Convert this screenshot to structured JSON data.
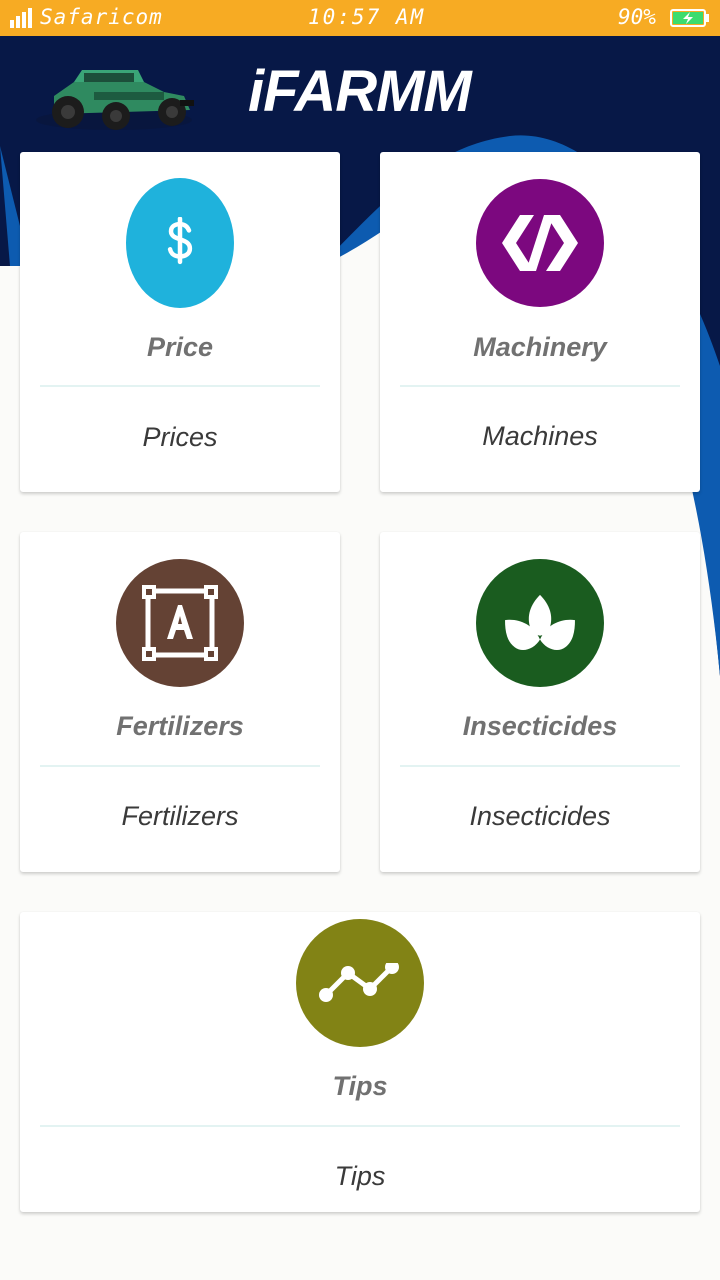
{
  "status_bar": {
    "carrier": "Safaricom",
    "time": "10:57 AM",
    "battery": "90%",
    "background": "#f7ab23"
  },
  "header": {
    "title": "iFARMM",
    "logo_icon": "tractor-icon",
    "background": "#071847",
    "accent": "#0d5bb0"
  },
  "cards": [
    {
      "title": "Price",
      "subtitle": "Prices",
      "icon": "dollar-icon",
      "color": "#1fb2dc"
    },
    {
      "title": "Machinery",
      "subtitle": "Machines",
      "icon": "polymer-icon",
      "color": "#7c087f"
    },
    {
      "title": "Fertilizers",
      "subtitle": "Fertilizers",
      "icon": "format-shapes-icon",
      "color": "#644234"
    },
    {
      "title": "Insecticides",
      "subtitle": "Insecticides",
      "icon": "spa-leaf-icon",
      "color": "#1a5c1f"
    },
    {
      "title": "Tips",
      "subtitle": "Tips",
      "icon": "trending-line-icon",
      "color": "#828315"
    }
  ]
}
